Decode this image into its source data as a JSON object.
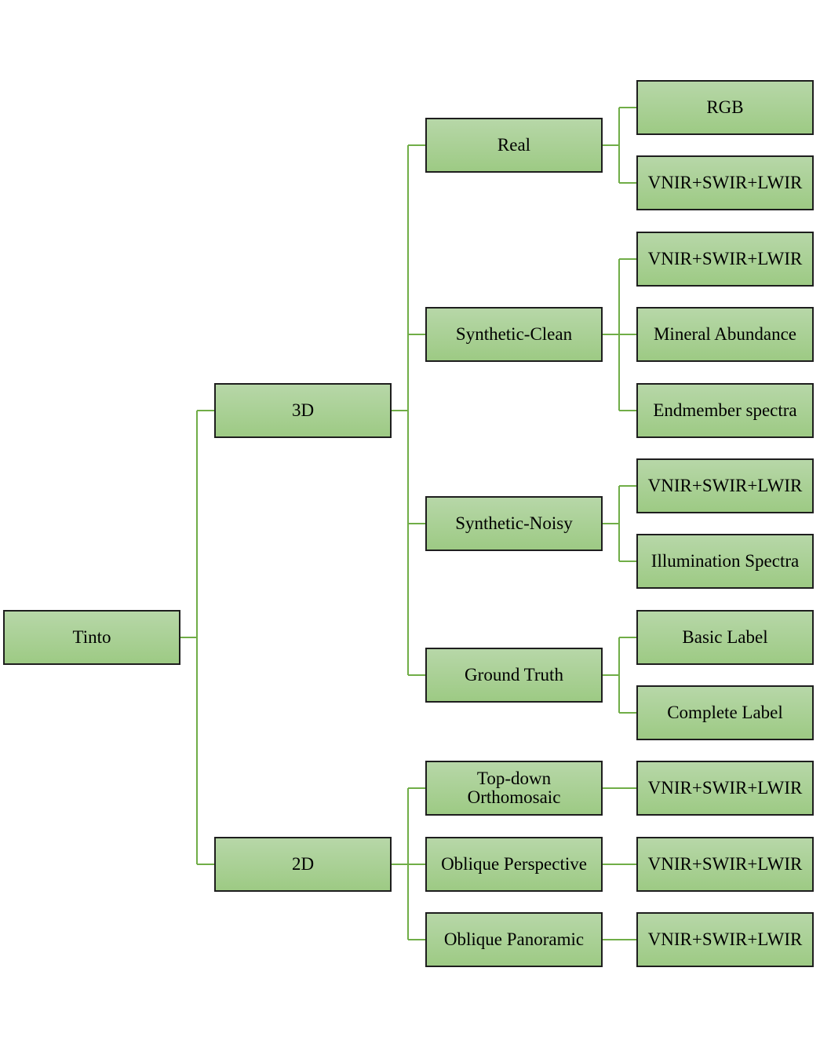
{
  "colors": {
    "connector": "#70ad47",
    "box_top": "#b7d7a8",
    "box_bottom": "#9dca84",
    "border": "#1e1e1e"
  },
  "tree": {
    "label": "Tinto",
    "children": [
      {
        "label": "3D",
        "children": [
          {
            "label": "Real",
            "children": [
              {
                "label": "RGB"
              },
              {
                "label": "VNIR+SWIR+LWIR"
              }
            ]
          },
          {
            "label": "Synthetic-Clean",
            "children": [
              {
                "label": "VNIR+SWIR+LWIR"
              },
              {
                "label": "Mineral Abundance"
              },
              {
                "label": "Endmember spectra"
              }
            ]
          },
          {
            "label": "Synthetic-Noisy",
            "children": [
              {
                "label": "VNIR+SWIR+LWIR"
              },
              {
                "label": "Illumination Spectra"
              }
            ]
          },
          {
            "label": "Ground Truth",
            "children": [
              {
                "label": "Basic Label"
              },
              {
                "label": "Complete Label"
              }
            ]
          }
        ]
      },
      {
        "label": "2D",
        "children": [
          {
            "label": "Top-down\nOrthomosaic",
            "children": [
              {
                "label": "VNIR+SWIR+LWIR"
              }
            ]
          },
          {
            "label": "Oblique Perspective",
            "children": [
              {
                "label": "VNIR+SWIR+LWIR"
              }
            ]
          },
          {
            "label": "Oblique Panoramic",
            "children": [
              {
                "label": "VNIR+SWIR+LWIR"
              }
            ]
          }
        ]
      }
    ]
  }
}
